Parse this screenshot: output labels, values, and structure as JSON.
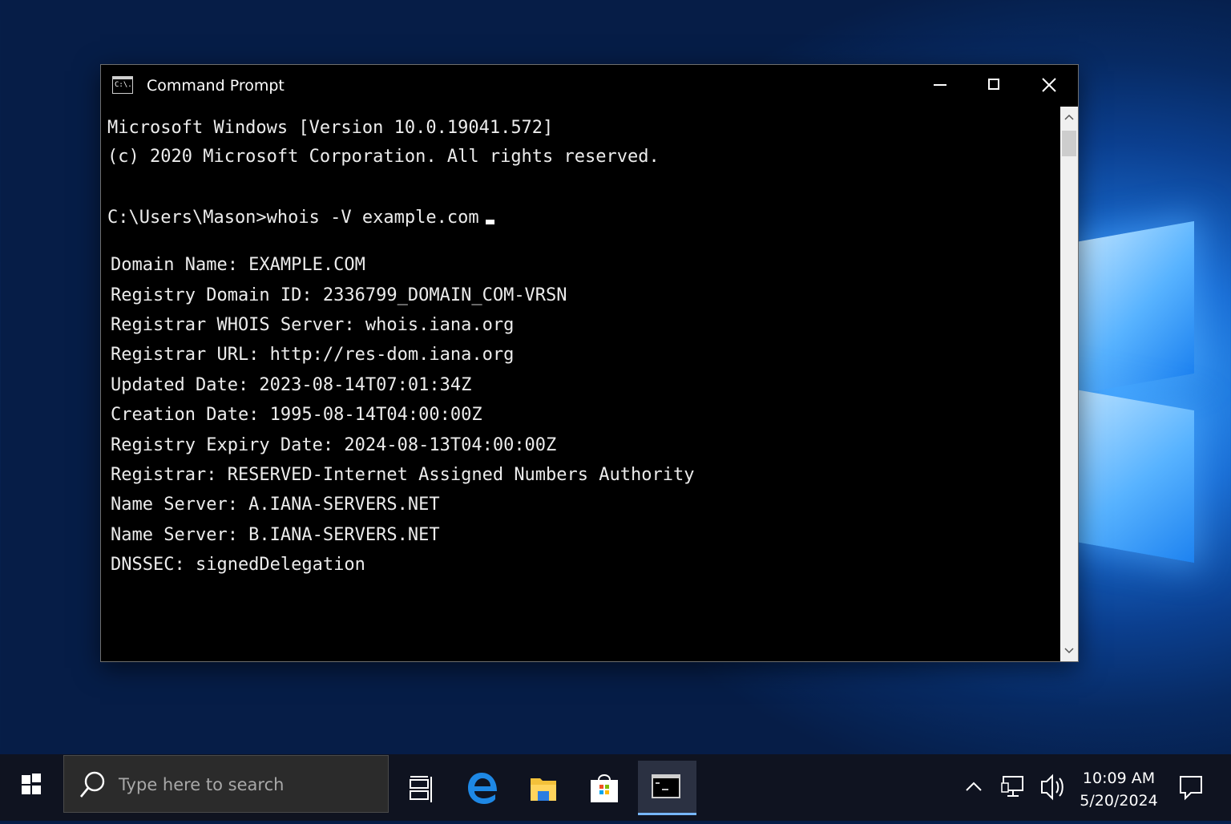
{
  "window": {
    "title": "Command Prompt",
    "icon_label": "C:\\."
  },
  "console": {
    "lines": [
      "Microsoft Windows [Version 10.0.19041.572]",
      "(c) 2020 Microsoft Corporation. All rights reserved.",
      "C:\\Users\\Mason>whois -V example.com"
    ],
    "output": [
      "Domain Name: EXAMPLE.COM",
      "Registry Domain ID: 2336799_DOMAIN_COM-VRSN",
      "Registrar WHOIS Server: whois.iana.org",
      "Registrar URL: http://res-dom.iana.org",
      "Updated Date: 2023-08-14T07:01:34Z",
      "Creation Date: 1995-08-14T04:00:00Z",
      "Registry Expiry Date: 2024-08-13T04:00:00Z",
      "Registrar: RESERVED-Internet Assigned Numbers Authority",
      "Name Server: A.IANA-SERVERS.NET",
      "Name Server: B.IANA-SERVERS.NET",
      "DNSSEC: signedDelegation"
    ]
  },
  "taskbar": {
    "search_placeholder": "Type here to search",
    "time": "10:09 AM",
    "date": "5/20/2024",
    "apps": [
      "task-view",
      "edge",
      "file-explorer",
      "microsoft-store",
      "command-prompt"
    ],
    "active_app": "command-prompt"
  },
  "colors": {
    "taskbar_bg": "#0f1320",
    "console_bg": "#000000",
    "console_fg": "#ececec",
    "accent": "#77b7ff"
  }
}
